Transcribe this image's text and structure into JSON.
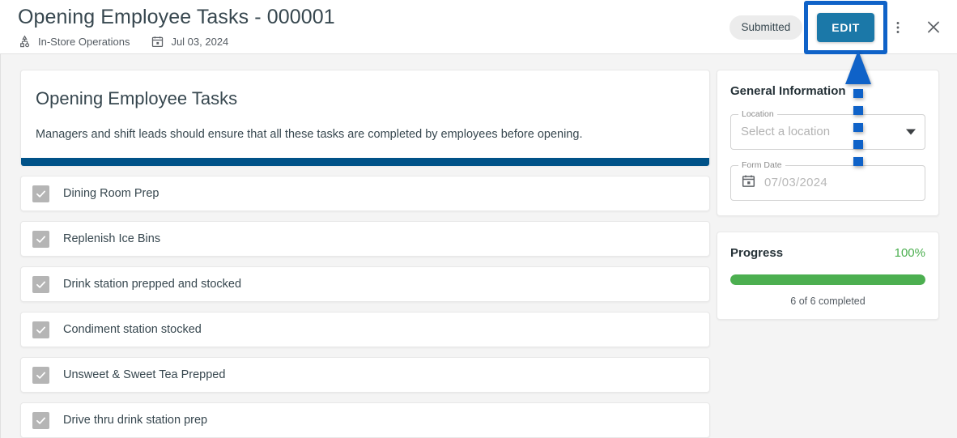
{
  "header": {
    "title": "Opening Employee Tasks - 000001",
    "meta": [
      {
        "icon": "hierarchy-icon",
        "label": "In-Store Operations"
      },
      {
        "icon": "calendar-icon",
        "label": "Jul 03, 2024"
      }
    ],
    "status_chip": "Submitted",
    "edit_label": "EDIT",
    "more_menu": "more-vertical-icon",
    "close": "close-icon"
  },
  "form": {
    "title": "Opening Employee Tasks",
    "description": "Managers and shift leads should ensure that all these tasks are completed by employees before opening.",
    "accent_color": "#005288"
  },
  "tasks": [
    {
      "label": "Dining Room Prep",
      "checked": true
    },
    {
      "label": "Replenish Ice Bins",
      "checked": true
    },
    {
      "label": "Drink station prepped and stocked",
      "checked": true
    },
    {
      "label": "Condiment station stocked",
      "checked": true
    },
    {
      "label": "Unsweet & Sweet Tea Prepped",
      "checked": true
    },
    {
      "label": "Drive thru drink station prep",
      "checked": true
    }
  ],
  "general_information": {
    "title": "General Information",
    "location": {
      "legend": "Location",
      "value": "Select a location",
      "is_placeholder": true
    },
    "form_date": {
      "legend": "Form Date",
      "value": "07/03/2024",
      "is_placeholder": true
    }
  },
  "progress": {
    "title": "Progress",
    "percent_label": "100%",
    "percent_value": 100,
    "caption": "6 of 6 completed",
    "fill_color": "#4caf50"
  },
  "annotation": {
    "type": "dashed-arrow",
    "color": "#0f62c8",
    "points_to": "edit-button",
    "dash_count": 5
  }
}
